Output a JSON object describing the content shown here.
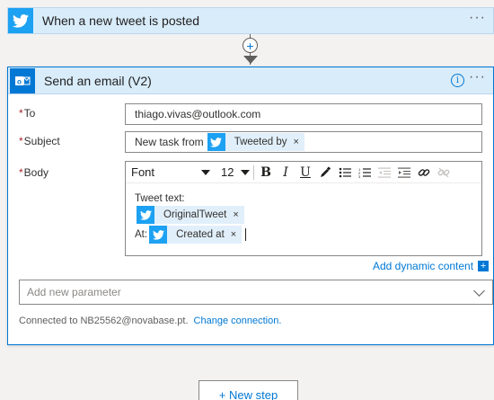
{
  "trigger": {
    "title": "When a new tweet is posted",
    "menu_icon": "more-icon"
  },
  "connector": {
    "add_icon": "plus-icon",
    "arrow_icon": "arrow-down-icon"
  },
  "action": {
    "title": "Send an email (V2)",
    "info_icon": "info-icon",
    "menu_icon": "more-icon",
    "fields": {
      "to": {
        "required_mark": "*",
        "label": "To",
        "value": "thiago.vivas@outlook.com"
      },
      "subject": {
        "required_mark": "*",
        "label": "Subject",
        "text": "New task from",
        "token": {
          "label": "Tweeted by",
          "remove": "×"
        }
      },
      "body": {
        "required_mark": "*",
        "label": "Body",
        "toolbar": {
          "font": "Font",
          "size": "12",
          "bold": "B",
          "italic": "I",
          "underline": "U"
        },
        "line1": "Tweet text:",
        "token1": {
          "label": "OriginalTweet",
          "remove": "×"
        },
        "line2_prefix": "At:",
        "token2": {
          "label": "Created at",
          "remove": "×"
        }
      }
    },
    "dynamic_content": {
      "label": "Add dynamic content",
      "icon": "+"
    },
    "add_parameter": {
      "placeholder": "Add new parameter"
    },
    "connection": {
      "text": "Connected to NB25562@novabase.pt.",
      "change_label": "Change connection."
    }
  },
  "new_step": {
    "label": "+ New step"
  },
  "colors": {
    "accent": "#0078d4",
    "twitter": "#1da1f2",
    "header_bg": "#d9ecfa",
    "token_bg": "#e1effa",
    "required": "#a4262c"
  }
}
